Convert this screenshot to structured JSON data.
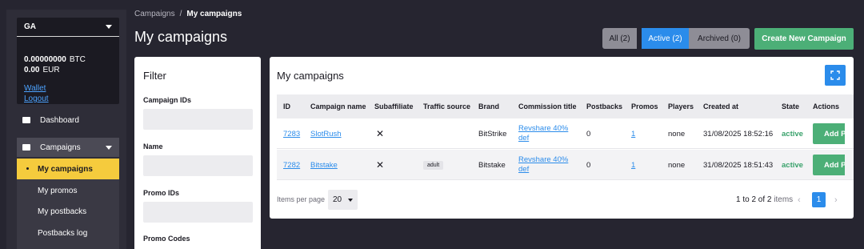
{
  "sidebar": {
    "currency": "GA",
    "balance_btc_amount": "0.00000000",
    "balance_btc_unit": "BTC",
    "balance_eur_amount": "0.00",
    "balance_eur_unit": "EUR",
    "wallet_link": "Wallet",
    "logout_link": "Logout",
    "dashboard": "Dashboard",
    "campaigns": "Campaigns",
    "sub_items": [
      "My campaigns",
      "My promos",
      "My postbacks",
      "Postbacks log"
    ]
  },
  "breadcrumb": {
    "parent": "Campaigns",
    "separator": "/",
    "current": "My campaigns"
  },
  "page_title": "My campaigns",
  "status_tabs": [
    "All (2)",
    "Active (2)",
    "Archived (0)"
  ],
  "active_tab": "Active (2)",
  "create_button": "Create New Campaign",
  "filter": {
    "title": "Filter",
    "fields": [
      "Campaign IDs",
      "Name",
      "Promo IDs",
      "Promo Codes"
    ]
  },
  "table": {
    "title": "My campaigns",
    "columns": [
      "ID",
      "Campaign name",
      "Subaffiliate",
      "Traffic source",
      "Brand",
      "Commission title",
      "Postbacks",
      "Promos",
      "Players",
      "Created at",
      "State",
      "Actions"
    ],
    "rows": [
      {
        "id": "7283",
        "name": "SlotRush",
        "subaffiliate": "✕",
        "traffic_source": "",
        "brand": "BitStrike",
        "commission": "Revshare 40% def",
        "postbacks": "0",
        "promos": "1",
        "players": "none",
        "created_at": "31/08/2025 18:52:16",
        "state": "active",
        "action": "Add P"
      },
      {
        "id": "7282",
        "name": "Bitstake",
        "subaffiliate": "✕",
        "traffic_source": "adult",
        "brand": "Bitstake",
        "commission": "Revshare 40% def",
        "postbacks": "0",
        "promos": "1",
        "players": "none",
        "created_at": "31/08/2025 18:51:43",
        "state": "active",
        "action": "Add P"
      }
    ]
  },
  "pagination": {
    "items_per_page_label": "Items per page",
    "items_per_page_value": "20",
    "range_text": "1 to 2 of 2",
    "range_unit": "items",
    "current_page": "1",
    "prev_glyph": "‹",
    "next_glyph": "›"
  },
  "colors": {
    "accent": "#2b8ceb",
    "success": "#4caf77",
    "highlight": "#f5cb3d",
    "background": "#262530"
  }
}
